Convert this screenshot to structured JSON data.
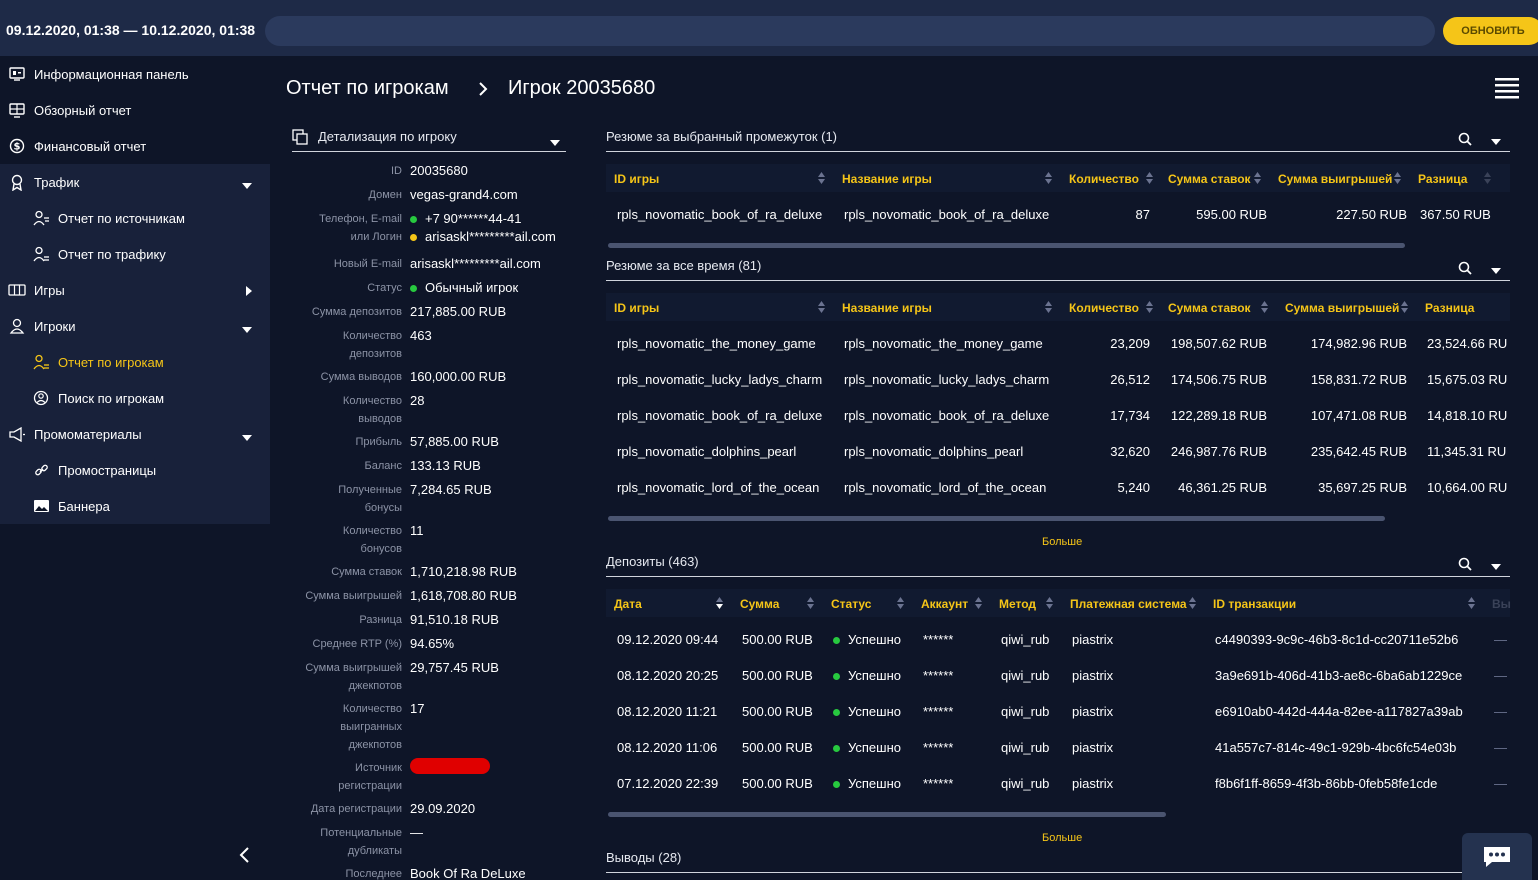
{
  "topbar": {
    "daterange": "09.12.2020, 01:38 — 10.12.2020, 01:38",
    "refresh": "ОБНОВИТЬ"
  },
  "sidebar": {
    "items": [
      {
        "label": "Информационная панель",
        "icon": "dashboard-icon"
      },
      {
        "label": "Обзорный отчет",
        "icon": "overview-icon"
      },
      {
        "label": "Финансовый отчет",
        "icon": "dollar-icon"
      },
      {
        "label": "Трафик",
        "icon": "pin-icon"
      },
      {
        "label": "Отчет по источникам",
        "icon": "source-icon"
      },
      {
        "label": "Отчет по трафику",
        "icon": "user-list-icon"
      },
      {
        "label": "Игры",
        "icon": "games-icon"
      },
      {
        "label": "Игроки",
        "icon": "players-icon"
      },
      {
        "label": "Отчет по игрокам",
        "icon": "player-report-icon"
      },
      {
        "label": "Поиск по игрокам",
        "icon": "player-search-icon"
      },
      {
        "label": "Промоматериалы",
        "icon": "megaphone-icon"
      },
      {
        "label": "Промостраницы",
        "icon": "link-icon"
      },
      {
        "label": "Баннера",
        "icon": "image-icon"
      }
    ]
  },
  "breadcrumb": {
    "parent": "Отчет по игрокам",
    "current": "Игрок 20035680"
  },
  "detail": {
    "title": "Детализация по игроку",
    "rows": [
      {
        "k": "ID",
        "v": "20035680"
      },
      {
        "k": "Домен",
        "v": "vegas-grand4.com"
      },
      {
        "k": "Телефон, E-mail",
        "v": "+7 90******44-41"
      },
      {
        "k": "или Логин",
        "v": "arisaskl*********ail.com"
      },
      {
        "k": "Новый E-mail",
        "v": "arisaskl*********ail.com"
      },
      {
        "k": "Статус",
        "v": "Обычный игрок"
      },
      {
        "k": "Сумма депозитов",
        "v": "217,885.00 RUB"
      },
      {
        "k": "Количество",
        "v": "463"
      },
      {
        "k": "депозитов",
        "v": ""
      },
      {
        "k": "Сумма выводов",
        "v": "160,000.00 RUB"
      },
      {
        "k": "Количество",
        "v": "28"
      },
      {
        "k": "выводов",
        "v": ""
      },
      {
        "k": "Прибыль",
        "v": "57,885.00 RUB"
      },
      {
        "k": "Баланс",
        "v": "133.13 RUB"
      },
      {
        "k": "Полученные",
        "v": "7,284.65 RUB"
      },
      {
        "k": "бонусы",
        "v": ""
      },
      {
        "k": "Количество",
        "v": "11"
      },
      {
        "k": "бонусов",
        "v": ""
      },
      {
        "k": "Сумма ставок",
        "v": "1,710,218.98 RUB"
      },
      {
        "k": "Сумма выигрышей",
        "v": "1,618,708.80 RUB"
      },
      {
        "k": "Разница",
        "v": "91,510.18 RUB"
      },
      {
        "k": "Среднее RTP (%)",
        "v": "94.65%"
      },
      {
        "k": "Сумма выигрышей",
        "v": "29,757.45 RUB"
      },
      {
        "k": "джекпотов",
        "v": ""
      },
      {
        "k": "Количество",
        "v": "17"
      },
      {
        "k": "выигранных",
        "v": ""
      },
      {
        "k": "джекпотов",
        "v": ""
      },
      {
        "k": "Источник",
        "v": ""
      },
      {
        "k": "регистрации",
        "v": ""
      },
      {
        "k": "Дата регистрации",
        "v": "29.09.2020"
      },
      {
        "k": "Потенциальные",
        "v": "—"
      },
      {
        "k": "дубликаты",
        "v": ""
      },
      {
        "k": "Последнее",
        "v": "Book Of Ra DeLuxe"
      }
    ]
  },
  "summary_period": {
    "title": "Резюме за выбранный промежуток (1)",
    "headers": [
      "ID игры",
      "Название игры",
      "Количество",
      "Сумма ставок",
      "Сумма выигрышей",
      "Разница"
    ],
    "rows": [
      [
        "rpls_novomatic_book_of_ra_deluxe",
        "rpls_novomatic_book_of_ra_deluxe",
        "87",
        "595.00 RUB",
        "227.50 RUB",
        "367.50 RUB"
      ]
    ]
  },
  "summary_all": {
    "title": "Резюме за все время (81)",
    "headers": [
      "ID игры",
      "Название игры",
      "Количество",
      "Сумма ставок",
      "Сумма выигрышей",
      "Разница"
    ],
    "rows": [
      [
        "rpls_novomatic_the_money_game",
        "rpls_novomatic_the_money_game",
        "23,209",
        "198,507.62 RUB",
        "174,982.96 RUB",
        "23,524.66 RU"
      ],
      [
        "rpls_novomatic_lucky_ladys_charm",
        "rpls_novomatic_lucky_ladys_charm",
        "26,512",
        "174,506.75 RUB",
        "158,831.72 RUB",
        "15,675.03 RU"
      ],
      [
        "rpls_novomatic_book_of_ra_deluxe",
        "rpls_novomatic_book_of_ra_deluxe",
        "17,734",
        "122,289.18 RUB",
        "107,471.08 RUB",
        "14,818.10 RU"
      ],
      [
        "rpls_novomatic_dolphins_pearl",
        "rpls_novomatic_dolphins_pearl",
        "32,620",
        "246,987.76 RUB",
        "235,642.45 RUB",
        "11,345.31 RU"
      ],
      [
        "rpls_novomatic_lord_of_the_ocean",
        "rpls_novomatic_lord_of_the_ocean",
        "5,240",
        "46,361.25 RUB",
        "35,697.25 RUB",
        "10,664.00 RU"
      ]
    ],
    "more": "Больше"
  },
  "deposits": {
    "title": "Депозиты (463)",
    "headers": [
      "Дата",
      "Сумма",
      "Статус",
      "Аккаунт",
      "Метод",
      "Платежная система",
      "ID транзакции",
      "Вы"
    ],
    "rows": [
      [
        "09.12.2020 09:44",
        "500.00 RUB",
        "Успешно",
        "******",
        "qiwi_rub",
        "piastrix",
        "c4490393-9c9c-46b3-8c1d-cc20711e52b6",
        "—"
      ],
      [
        "08.12.2020 20:25",
        "500.00 RUB",
        "Успешно",
        "******",
        "qiwi_rub",
        "piastrix",
        "3a9e691b-406d-41b3-ae8c-6ba6ab1229ce",
        "—"
      ],
      [
        "08.12.2020 11:21",
        "500.00 RUB",
        "Успешно",
        "******",
        "qiwi_rub",
        "piastrix",
        "e6910ab0-442d-444a-82ee-a117827a39ab",
        "—"
      ],
      [
        "08.12.2020 11:06",
        "500.00 RUB",
        "Успешно",
        "******",
        "qiwi_rub",
        "piastrix",
        "41a557c7-814c-49c1-929b-4bc6fc54e03b",
        "—"
      ],
      [
        "07.12.2020 22:39",
        "500.00 RUB",
        "Успешно",
        "******",
        "qiwi_rub",
        "piastrix",
        "f8b6f1ff-8659-4f3b-86bb-0feb58fe1cde",
        "—"
      ]
    ],
    "more": "Больше"
  },
  "withdrawals": {
    "title": "Выводы (28)"
  },
  "colors": {
    "accent": "#f5c518",
    "success": "#27c93f",
    "warning": "#f5c518"
  }
}
